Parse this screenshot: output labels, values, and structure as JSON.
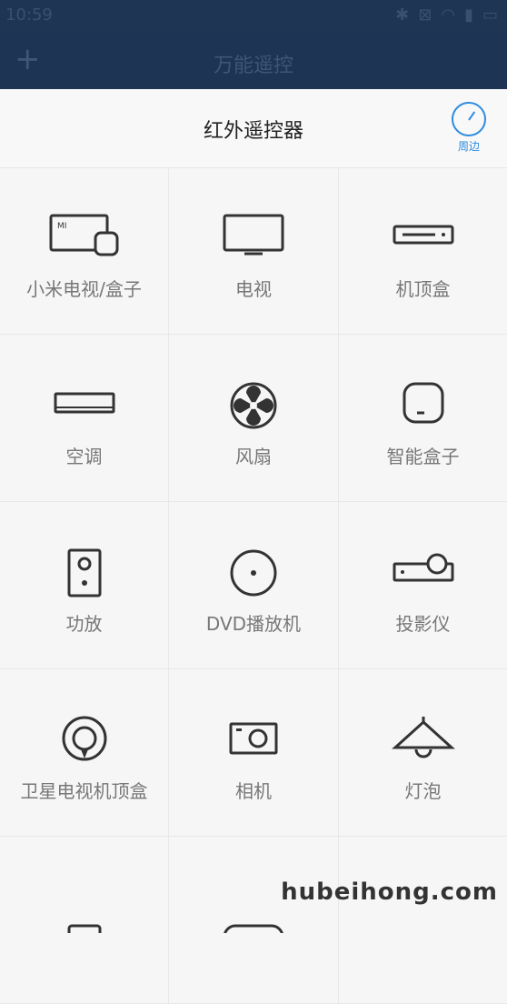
{
  "status": {
    "time": "10:59"
  },
  "header": {
    "add_icon": "plus-icon",
    "title": "万能遥控"
  },
  "subheader": {
    "title": "红外遥控器",
    "nearby_label": "周边"
  },
  "devices": [
    {
      "name": "小米电视/盒子",
      "icon": "mi-tv-box-icon"
    },
    {
      "name": "电视",
      "icon": "tv-icon"
    },
    {
      "name": "机顶盒",
      "icon": "set-top-box-icon"
    },
    {
      "name": "空调",
      "icon": "air-conditioner-icon"
    },
    {
      "name": "风扇",
      "icon": "fan-icon"
    },
    {
      "name": "智能盒子",
      "icon": "smart-box-icon"
    },
    {
      "name": "功放",
      "icon": "amplifier-icon"
    },
    {
      "name": "DVD播放机",
      "icon": "dvd-icon"
    },
    {
      "name": "投影仪",
      "icon": "projector-icon"
    },
    {
      "name": "卫星电视机顶盒",
      "icon": "satellite-icon"
    },
    {
      "name": "相机",
      "icon": "camera-icon"
    },
    {
      "name": "灯泡",
      "icon": "lamp-icon"
    }
  ],
  "watermark": "hubeihong.com"
}
